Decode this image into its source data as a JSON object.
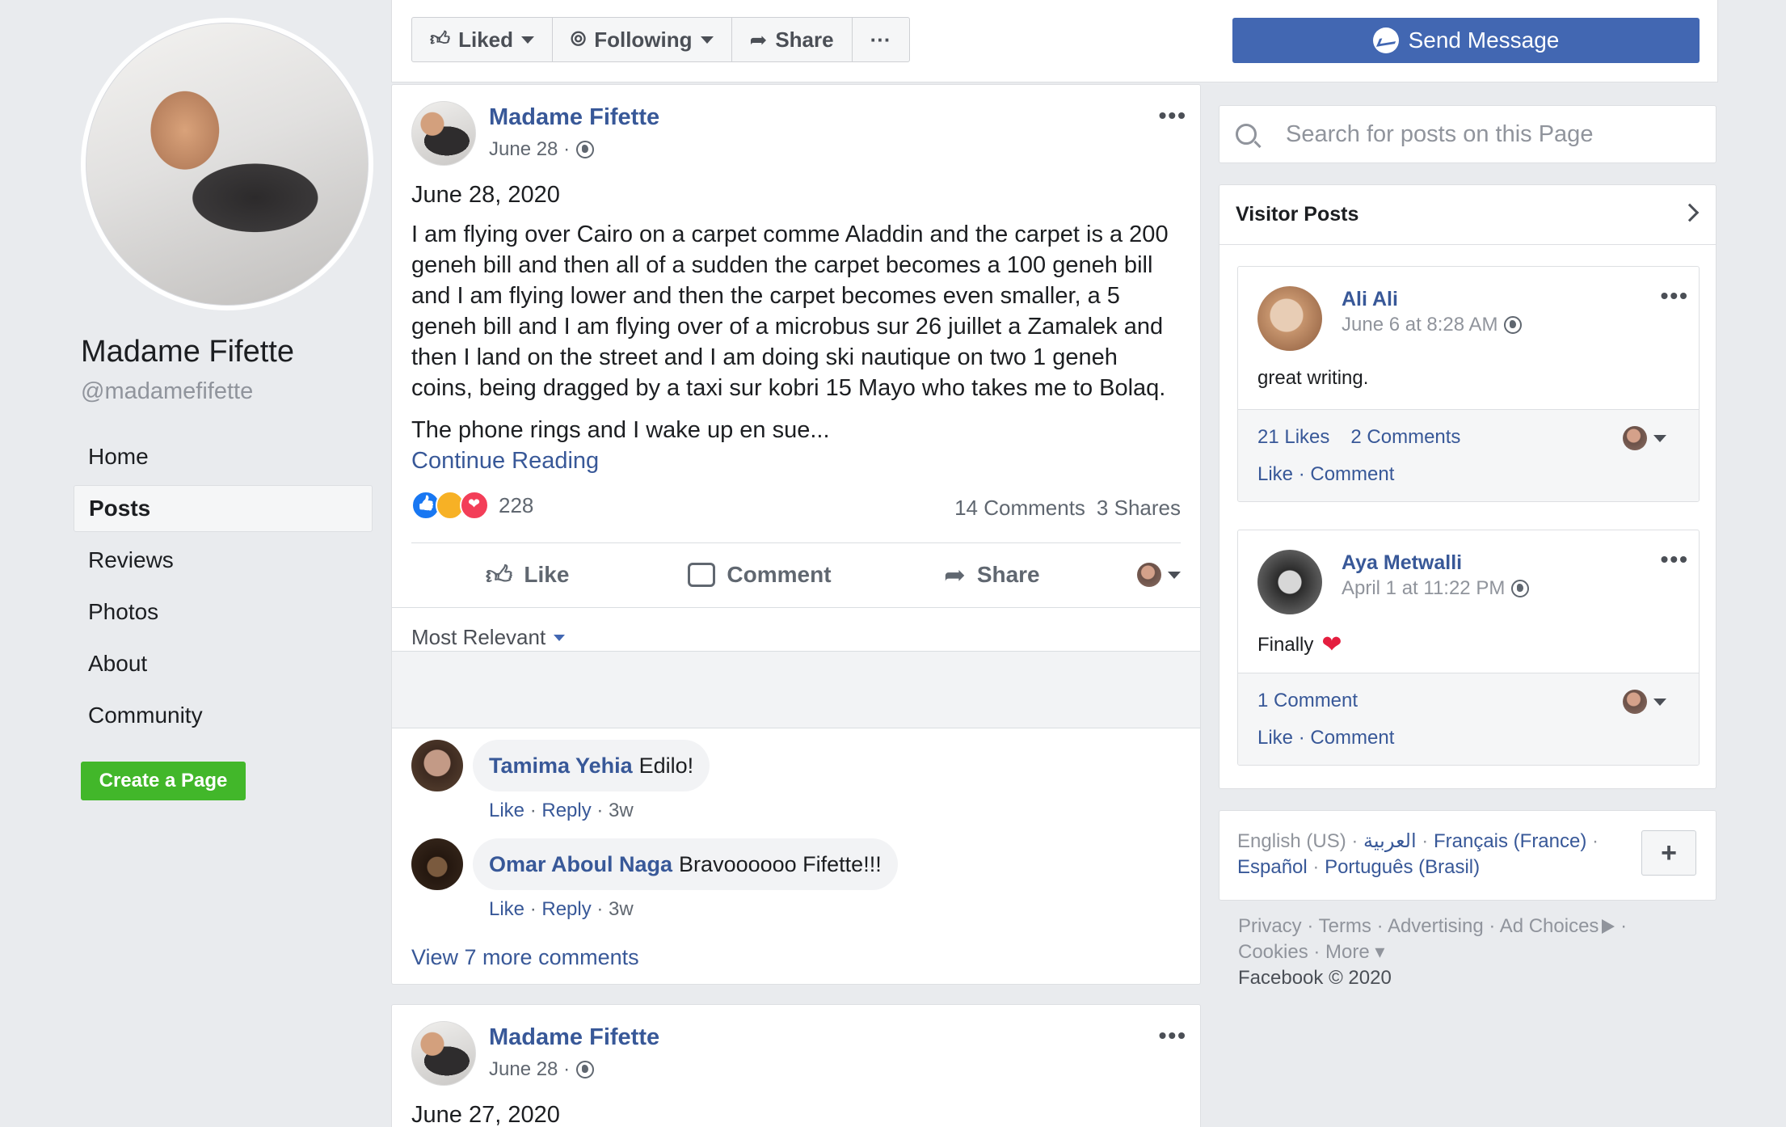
{
  "profile": {
    "name": "Madame Fifette",
    "handle": "@madamefifette"
  },
  "left_nav": {
    "items": [
      {
        "label": "Home"
      },
      {
        "label": "Posts"
      },
      {
        "label": "Reviews"
      },
      {
        "label": "Photos"
      },
      {
        "label": "About"
      },
      {
        "label": "Community"
      }
    ],
    "active": "Posts",
    "create_page_label": "Create a Page"
  },
  "topbar": {
    "liked_label": "Liked",
    "following_label": "Following",
    "share_label": "Share",
    "more_label": "···",
    "send_message_label": "Send Message"
  },
  "post1": {
    "author": "Madame Fifette",
    "time": "June 28 ·",
    "date_line": "June 28, 2020",
    "body": "I am flying over Cairo on a carpet comme Aladdin and the carpet is a 200 geneh bill and then all of a sudden the carpet becomes a 100 geneh bill and I am flying lower and then the carpet becomes even smaller, a 5 geneh bill and I am flying over of a microbus sur 26 juillet a Zamalek and then I land on the street and I am doing ski nautique on two 1 geneh coins, being dragged by a taxi sur kobri 15 Mayo who takes me to Bolaq.",
    "body2": "The phone rings and I wake up en sue...",
    "continue_label": "Continue Reading",
    "reaction_count": "228",
    "comments_count": "14 Comments",
    "shares_count": "3 Shares",
    "like_label": "Like",
    "comment_label": "Comment",
    "share_label": "Share",
    "sort_label": "Most Relevant",
    "comments": [
      {
        "name": "Tamima Yehia",
        "text": "Edilo!",
        "like": "Like",
        "reply": "Reply",
        "age": "3w"
      },
      {
        "name": "Omar Aboul Naga",
        "text": "Bravoooooo Fifette!!!",
        "like": "Like",
        "reply": "Reply",
        "age": "3w"
      }
    ],
    "view_more": "View 7 more comments"
  },
  "post2": {
    "author": "Madame Fifette",
    "time": "June 28 ·",
    "date_line": "June 27, 2020"
  },
  "search": {
    "placeholder": "Search for posts on this Page"
  },
  "visitor_posts": {
    "title": "Visitor Posts",
    "posts": [
      {
        "name": "Ali Ali",
        "time": "June 6 at 8:28 AM",
        "text": "great writing.",
        "likes": "21 Likes",
        "comments": "2 Comments",
        "like": "Like",
        "comment": "Comment"
      },
      {
        "name": "Aya Metwalli",
        "time": "April 1 at 11:22 PM",
        "text": "Finally",
        "comments": "1 Comment",
        "like": "Like",
        "comment": "Comment"
      }
    ]
  },
  "languages": {
    "current": "English (US)",
    "arabic": "العربية",
    "french": "Français (France)",
    "spanish": "Español",
    "portuguese": "Português (Brasil)",
    "add_label": "+"
  },
  "footer": {
    "privacy": "Privacy",
    "terms": "Terms",
    "advertising": "Advertising",
    "ad_choices": "Ad Choices",
    "cookies": "Cookies",
    "more": "More",
    "copyright": "Facebook © 2020"
  },
  "colors": {
    "brand_blue": "#4267b2",
    "link_blue": "#385898",
    "create_green": "#42b72a",
    "background": "#e9ebee"
  }
}
